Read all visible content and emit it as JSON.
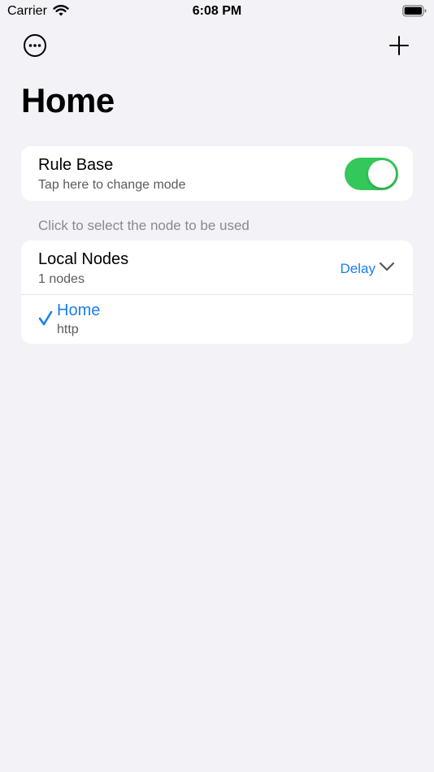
{
  "status_bar": {
    "carrier": "Carrier",
    "time": "6:08 PM"
  },
  "nav": {
    "more_icon": "ellipsis-circle-icon",
    "add_icon": "plus-icon"
  },
  "page": {
    "title": "Home"
  },
  "mode_card": {
    "title": "Rule Base",
    "subtitle": "Tap here to change mode",
    "toggle_on": true
  },
  "section_hint": "Click to select the node to be used",
  "node_group": {
    "title": "Local Nodes",
    "count_text": "1 nodes",
    "sort_label": "Delay",
    "nodes": [
      {
        "name": "Home",
        "type": "http",
        "selected": true
      }
    ]
  },
  "colors": {
    "accent": "#1a7ff0",
    "toggle_on": "#34c759",
    "background": "#f2f2f7"
  }
}
